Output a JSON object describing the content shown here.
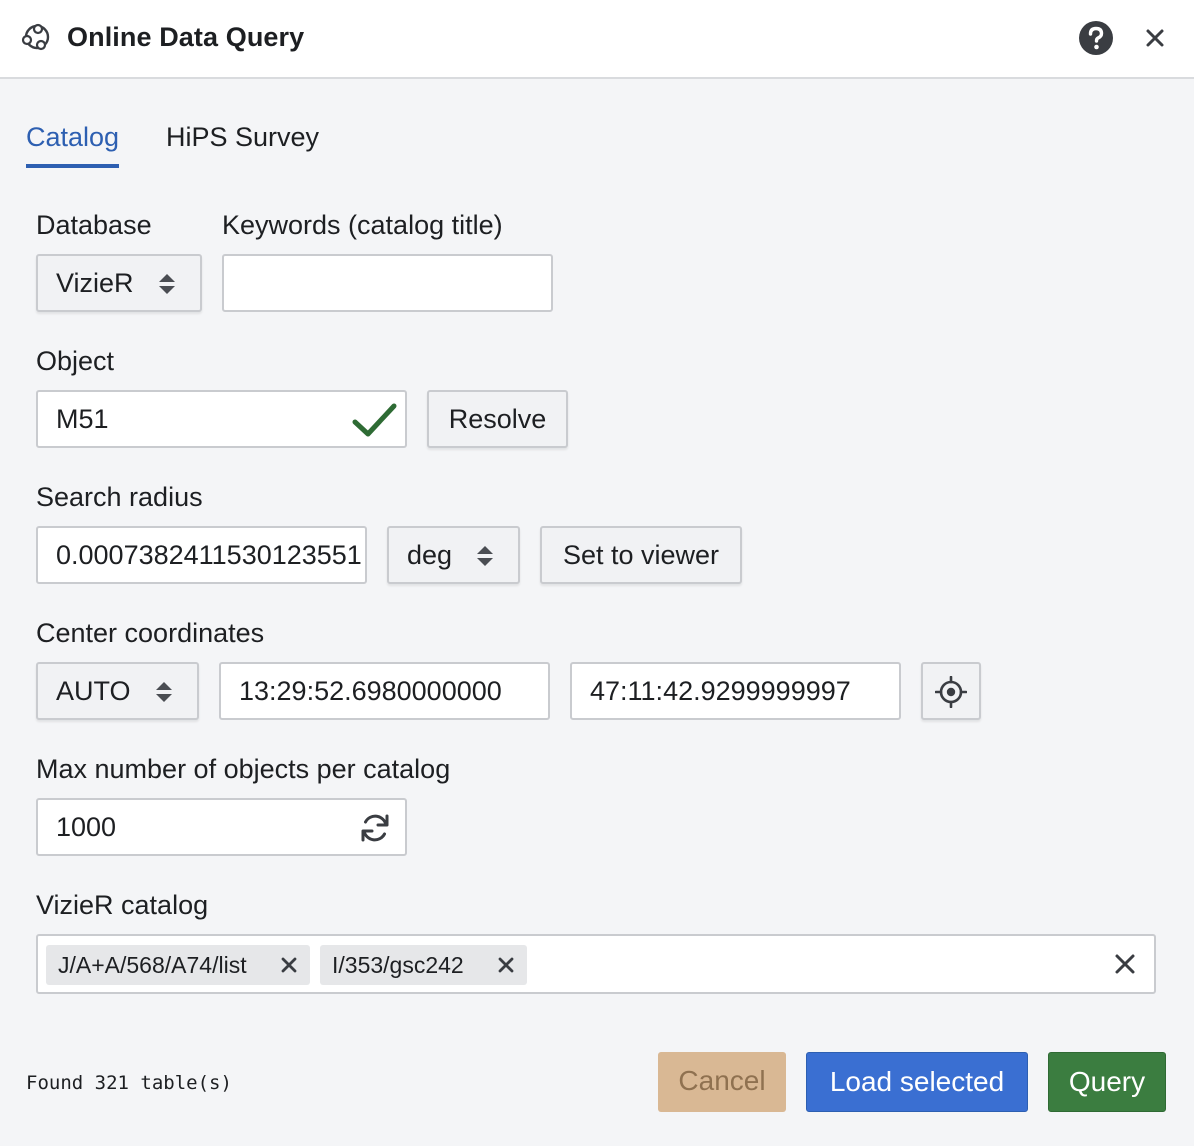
{
  "window": {
    "title": "Online Data Query",
    "icons": {
      "app": "astronomy-query-icon",
      "help": "help-icon",
      "close": "close-icon"
    }
  },
  "tabs": [
    {
      "label": "Catalog",
      "active": true
    },
    {
      "label": "HiPS Survey",
      "active": false
    }
  ],
  "form": {
    "database": {
      "label": "Database",
      "value": "VizieR"
    },
    "keywords": {
      "label": "Keywords (catalog title)",
      "value": ""
    },
    "object": {
      "label": "Object",
      "value": "M51",
      "resolved": true,
      "resolve_label": "Resolve"
    },
    "radius": {
      "label": "Search radius",
      "value": "0.0007382411530123551",
      "unit": "deg",
      "set_to_viewer_label": "Set to viewer"
    },
    "center": {
      "label": "Center coordinates",
      "frame": "AUTO",
      "ra": "13:29:52.6980000000",
      "dec": "47:11:42.9299999997"
    },
    "max_objects": {
      "label": "Max number of objects per catalog",
      "value": "1000"
    },
    "catalog": {
      "label": "VizieR catalog",
      "selected": [
        "J/A+A/568/A74/list",
        "I/353/gsc242"
      ]
    }
  },
  "footer": {
    "status": "Found 321 table(s)",
    "cancel_label": "Cancel",
    "load_label": "Load selected",
    "query_label": "Query"
  },
  "colors": {
    "accent": "#2d5fb1",
    "check": "#2e6b34",
    "cancel": "#d9b894",
    "load": "#3a6fd2",
    "query": "#3b7d40"
  }
}
